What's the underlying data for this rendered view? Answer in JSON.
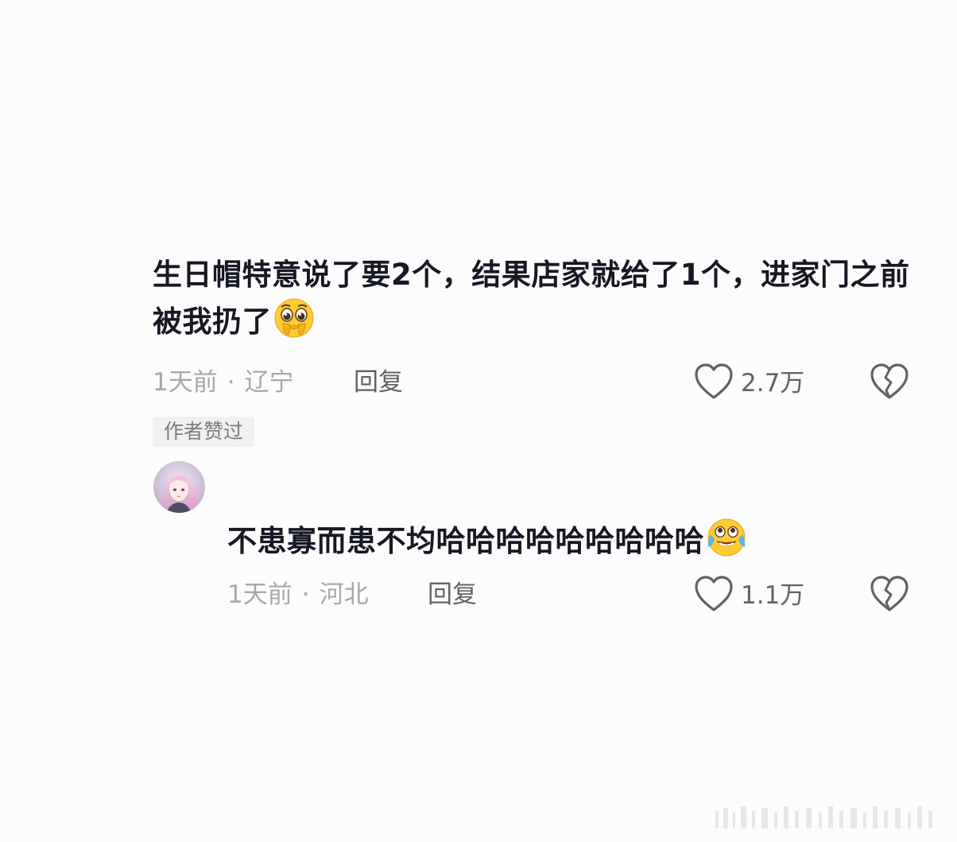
{
  "comment": {
    "text": "生日帽特意说了要2个，结果店家就给了1个，进家门之前被我扔了",
    "emoji": "pleading-face-icon",
    "time": "1天前",
    "separator": "·",
    "location": "辽宁",
    "reply_label": "回复",
    "likes": "2.7万",
    "badge": "作者赞过"
  },
  "reply": {
    "text": "不患寡而患不均哈哈哈哈哈哈哈哈哈",
    "emoji": "laughing-tears-icon",
    "time": "1天前",
    "separator": "·",
    "location": "河北",
    "reply_label": "回复",
    "likes": "1.1万"
  },
  "colors": {
    "text": "#161823",
    "meta": "#a7a8ad",
    "action": "#616268",
    "badge_bg": "#f0f0f1"
  }
}
